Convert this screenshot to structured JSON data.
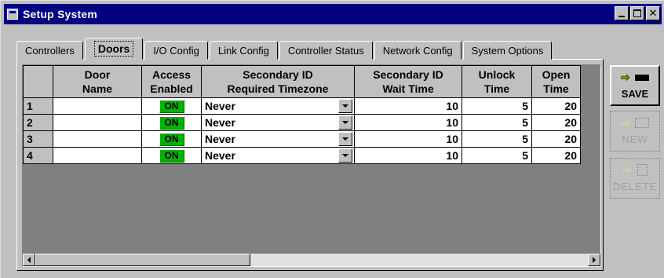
{
  "window": {
    "title": "Setup System"
  },
  "tabs": [
    {
      "label": "Controllers",
      "active": false
    },
    {
      "label": "Doors",
      "active": true
    },
    {
      "label": "I/O Config",
      "active": false
    },
    {
      "label": "Link Config",
      "active": false
    },
    {
      "label": "Controller Status",
      "active": false
    },
    {
      "label": "Network Config",
      "active": false
    },
    {
      "label": "System Options",
      "active": false
    }
  ],
  "grid": {
    "columns": [
      {
        "line1": "Door",
        "line2": "Name"
      },
      {
        "line1": "Access",
        "line2": "Enabled"
      },
      {
        "line1": "Secondary ID",
        "line2": "Required Timezone"
      },
      {
        "line1": "Secondary ID",
        "line2": "Wait Time"
      },
      {
        "line1": "Unlock",
        "line2": "Time"
      },
      {
        "line1": "Open",
        "line2": "Time"
      }
    ],
    "rows": [
      {
        "num": "1",
        "door_name": "",
        "access": "ON",
        "timezone": "Never",
        "wait": "10",
        "unlock": "5",
        "open": "20"
      },
      {
        "num": "2",
        "door_name": "",
        "access": "ON",
        "timezone": "Never",
        "wait": "10",
        "unlock": "5",
        "open": "20"
      },
      {
        "num": "3",
        "door_name": "",
        "access": "ON",
        "timezone": "Never",
        "wait": "10",
        "unlock": "5",
        "open": "20"
      },
      {
        "num": "4",
        "door_name": "",
        "access": "ON",
        "timezone": "Never",
        "wait": "10",
        "unlock": "5",
        "open": "20"
      }
    ]
  },
  "buttons": {
    "save": "SAVE",
    "new": "NEW",
    "delete": "DELETE"
  },
  "icons": {
    "title": "window-app-icon",
    "arrow": "right-arrow-icon",
    "save": "disk-icon",
    "new": "page-icon",
    "delete": "trash-icon"
  },
  "colors": {
    "titlebar": "#000080",
    "on_badge": "#00b000",
    "face": "#c0c0c0"
  }
}
